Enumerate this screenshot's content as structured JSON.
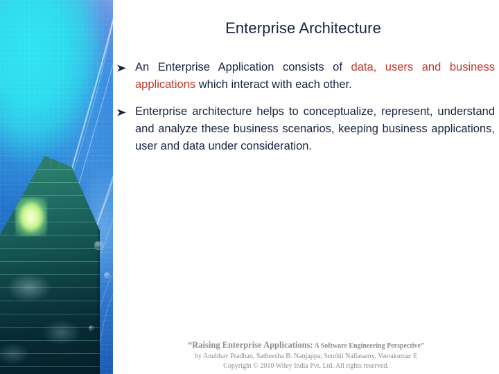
{
  "slide": {
    "title": "Enterprise Architecture",
    "bullet_glyph": "arrowhead-bullet",
    "colors": {
      "text": "#17233f",
      "highlight_red": "#c0392b",
      "footer_gray": "#8d8d8d",
      "panel_blue": "#1f6fc4",
      "panel_cyan": "#2fe4f2"
    },
    "bullets": [
      {
        "id": "bullet-1",
        "segments": [
          {
            "text": "An Enterprise Application consists of ",
            "style": "normal"
          },
          {
            "text": "data, users  and business applications",
            "style": "red"
          },
          {
            "text": " which interact with each other.",
            "style": "normal"
          }
        ],
        "plain": "An Enterprise Application consists of data, users and business applications which interact with each other."
      },
      {
        "id": "bullet-2",
        "segments": [
          {
            "text": "Enterprise architecture helps to conceptualize, represent, understand and analyze these business scenarios, keeping business applications, user and data under consideration.",
            "style": "normal"
          }
        ],
        "plain": "Enterprise architecture helps to conceptualize, represent, understand and analyze these business scenarios, keeping business applications, user and data under consideration."
      }
    ]
  },
  "image_panel": {
    "name": "skyscraper-abstract-blue-image",
    "description": "Glass skyscraper tower with cyan and blue abstract light overlay"
  },
  "footer": {
    "book_title_main": "“Raising Enterprise Applications:",
    "book_title_sub": " A Software Engineering Perspective”",
    "authors": "by Anubhav Pradhan, Satheesha B. Nanjappa, Senthil Nallasamy, Veerakumar E",
    "copyright": "Copyright © 2010 Wiley India Pvt. Ltd.  All rights reserved."
  }
}
